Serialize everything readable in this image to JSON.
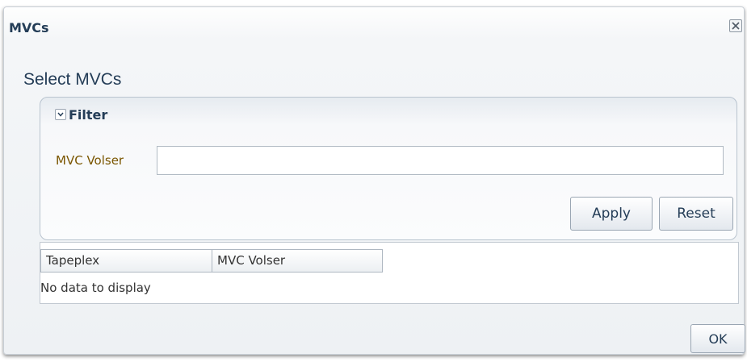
{
  "dialog": {
    "title": "MVCs",
    "heading": "Select MVCs",
    "close_icon": "close-icon"
  },
  "filter": {
    "label": "Filter",
    "expanded": true,
    "field_label": "MVC Volser",
    "field_value": "",
    "apply_label": "Apply",
    "reset_label": "Reset"
  },
  "table": {
    "columns": [
      "Tapeplex",
      "MVC Volser"
    ],
    "empty_message": "No data to display"
  },
  "footer": {
    "ok_label": "OK"
  }
}
